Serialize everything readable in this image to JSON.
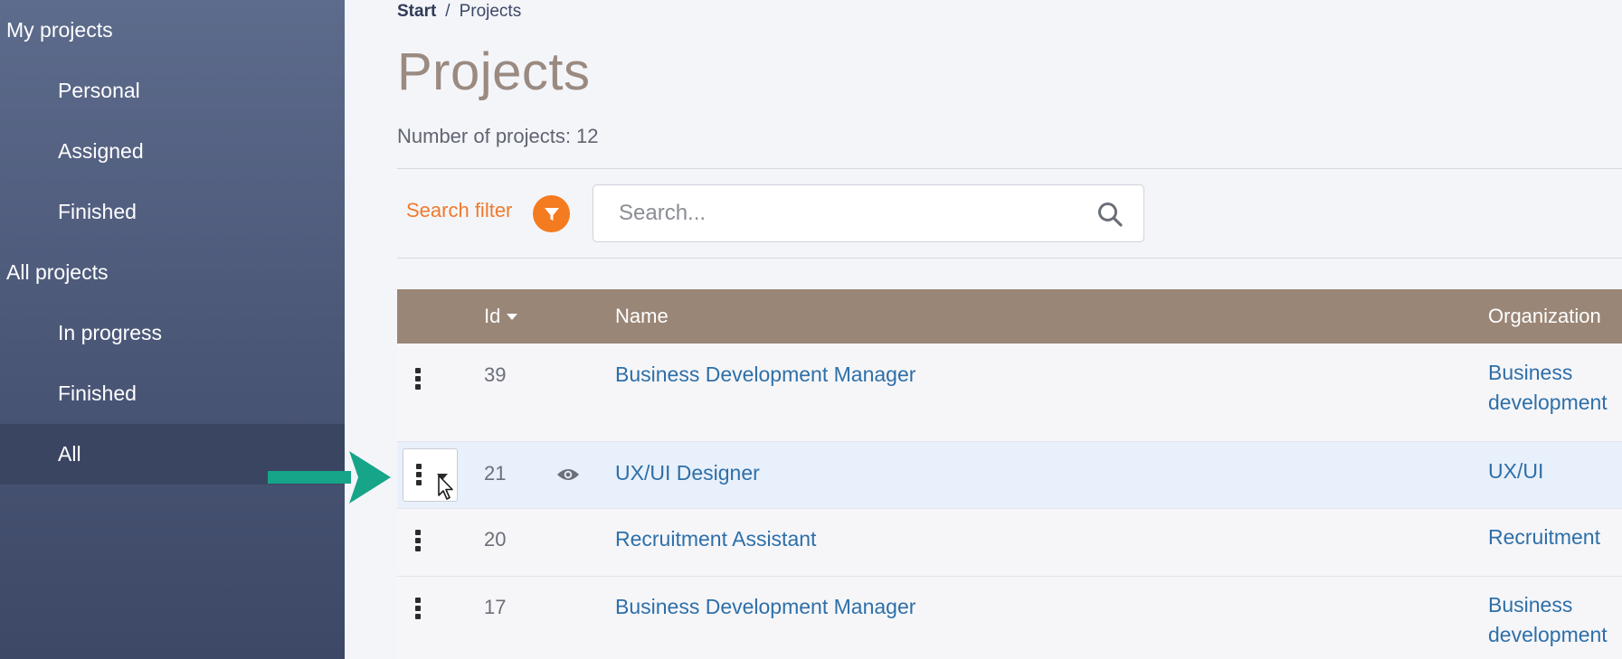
{
  "sidebar": {
    "items": [
      {
        "label": "My projects"
      },
      {
        "label": "Personal"
      },
      {
        "label": "Assigned"
      },
      {
        "label": "Finished"
      },
      {
        "label": "All projects"
      },
      {
        "label": "In progress"
      },
      {
        "label": "Finished"
      },
      {
        "label": "All"
      }
    ],
    "active": "All"
  },
  "breadcrumb": {
    "start": "Start",
    "separator": "/",
    "current": "Projects"
  },
  "page": {
    "title": "Projects",
    "count_label": "Number of projects:",
    "count": "12"
  },
  "filter": {
    "label": "Search filter",
    "icon": "filter-icon"
  },
  "search": {
    "placeholder": "Search...",
    "value": "",
    "icon": "search-icon"
  },
  "table": {
    "columns": {
      "id": "Id",
      "name": "Name",
      "organization": "Organization"
    },
    "sort": {
      "column": "Id",
      "direction": "desc"
    },
    "rows": [
      {
        "id": "39",
        "name": "Business Development Manager",
        "org_line1": "Business",
        "org_line2": "development"
      },
      {
        "id": "21",
        "name": "UX/UI Designer",
        "org_line1": "UX/UI",
        "org_line2": "",
        "viewed": true,
        "menu_open": true
      },
      {
        "id": "20",
        "name": "Recruitment Assistant",
        "org_line1": "Recruitment",
        "org_line2": ""
      },
      {
        "id": "17",
        "name": "Business Development Manager",
        "org_line1": "Business",
        "org_line2": "development"
      }
    ]
  },
  "colors": {
    "sidebar_top": "#5d6b8c",
    "sidebar_bottom": "#3d4866",
    "table_header": "#9a8677",
    "accent_orange": "#f47b20",
    "link_blue": "#2e6fa8",
    "title_brown": "#9a8a80",
    "annotation_arrow": "#17a589"
  }
}
